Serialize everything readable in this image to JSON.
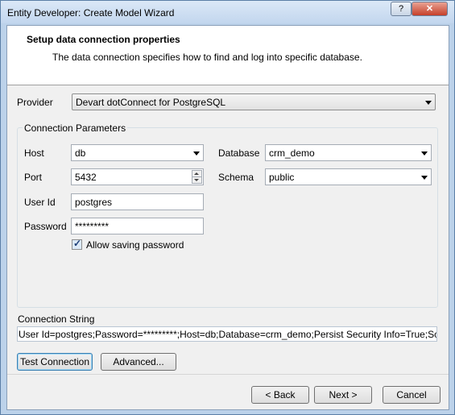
{
  "window": {
    "title": "Entity Developer: Create Model Wizard",
    "help_label": "?",
    "close_label": "✕"
  },
  "header": {
    "title": "Setup data connection properties",
    "description": "The data connection specifies how to find and log into specific database."
  },
  "provider": {
    "label": "Provider",
    "value": "Devart dotConnect for PostgreSQL"
  },
  "connection_parameters": {
    "caption": "Connection Parameters",
    "host": {
      "label": "Host",
      "value": "db"
    },
    "port": {
      "label": "Port",
      "value": "5432"
    },
    "user_id": {
      "label": "User Id",
      "value": "postgres"
    },
    "password": {
      "label": "Password",
      "value": "*********"
    },
    "database": {
      "label": "Database",
      "value": "crm_demo"
    },
    "schema": {
      "label": "Schema",
      "value": "public"
    },
    "allow_saving_password": {
      "label": "Allow saving password",
      "checked": true,
      "mark": "✓"
    }
  },
  "connection_string": {
    "label": "Connection String",
    "value": "User Id=postgres;Password=*********;Host=db;Database=crm_demo;Persist Security Info=True;Schema=public"
  },
  "buttons": {
    "test_connection": "Test Connection",
    "advanced": "Advanced...",
    "back": "< Back",
    "next": "Next >",
    "cancel": "Cancel"
  }
}
